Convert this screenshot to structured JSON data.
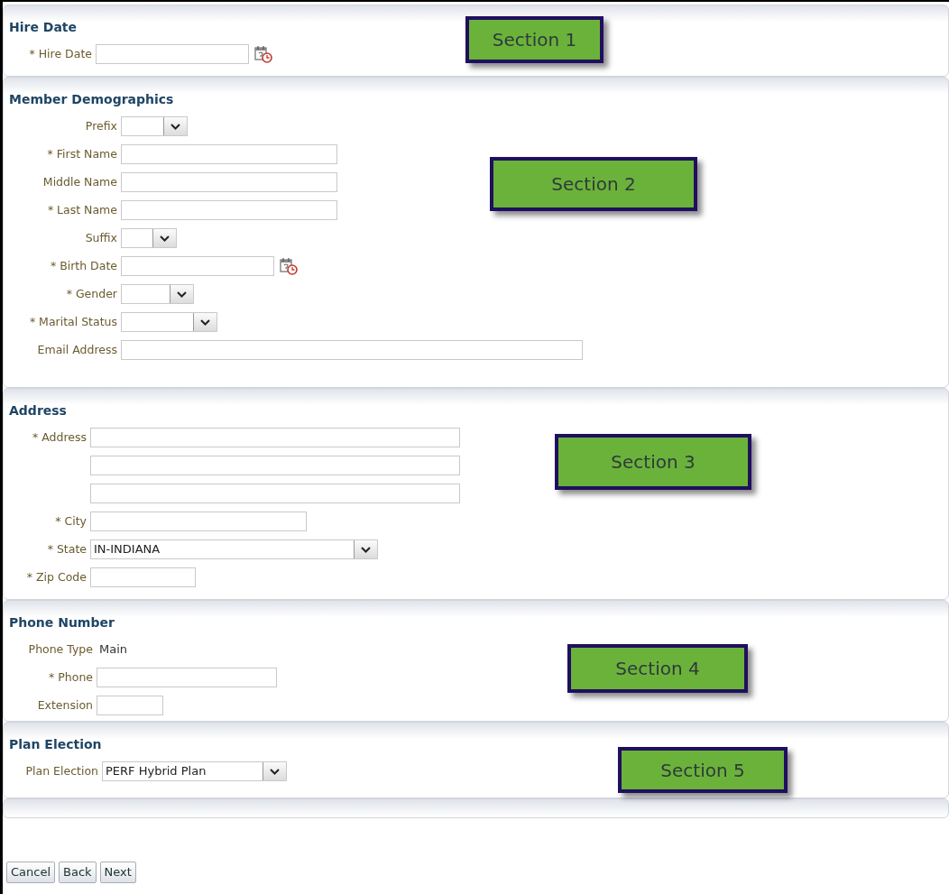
{
  "sections": [
    {
      "title": "Hire Date",
      "callout": "Section 1",
      "fields": [
        {
          "kind": "date",
          "label": "* Hire Date"
        }
      ]
    },
    {
      "title": "Member Demographics",
      "callout": "Section 2",
      "fields": [
        {
          "kind": "select",
          "label": "Prefix"
        },
        {
          "kind": "text",
          "label": "* First Name"
        },
        {
          "kind": "text",
          "label": "Middle Name"
        },
        {
          "kind": "text",
          "label": "* Last Name"
        },
        {
          "kind": "select",
          "label": "Suffix"
        },
        {
          "kind": "date",
          "label": "* Birth Date"
        },
        {
          "kind": "select",
          "label": "* Gender"
        },
        {
          "kind": "select",
          "label": "* Marital Status"
        },
        {
          "kind": "text",
          "label": "Email Address"
        }
      ]
    },
    {
      "title": "Address",
      "callout": "Section 3",
      "fields": [
        {
          "kind": "text",
          "label": "* Address"
        },
        {
          "kind": "text"
        },
        {
          "kind": "text"
        },
        {
          "kind": "text",
          "label": "* City"
        },
        {
          "kind": "select",
          "label": "* State",
          "value": "IN-INDIANA"
        },
        {
          "kind": "text",
          "label": "* Zip Code"
        }
      ]
    },
    {
      "title": "Phone Number",
      "callout": "Section 4",
      "fields": [
        {
          "kind": "readonly",
          "label": "Phone Type",
          "value": "Main"
        },
        {
          "kind": "text",
          "label": "* Phone"
        },
        {
          "kind": "text",
          "label": "Extension"
        }
      ]
    },
    {
      "title": "Plan Election",
      "callout": "Section 5",
      "fields": [
        {
          "kind": "select",
          "label": "Plan Election",
          "value": "PERF Hybrid Plan"
        }
      ]
    }
  ],
  "buttons": [
    "Cancel",
    "Back",
    "Next"
  ]
}
